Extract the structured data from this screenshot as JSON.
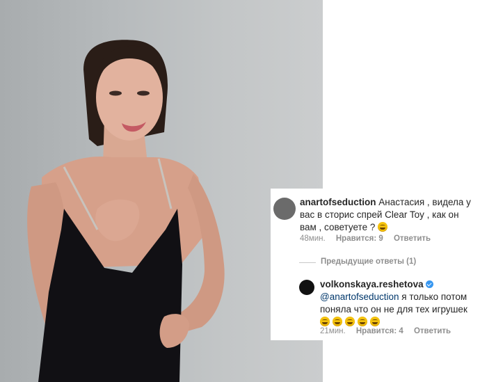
{
  "comments": [
    {
      "username": "anartofseduction",
      "text": "Анастасия , видела у вас в сторис спрей Clear Toy , как  он вам , советуете ?",
      "time": "48мин.",
      "likes": "Нравится: 9",
      "reply": "Ответить"
    },
    {
      "username": "volkonskaya.reshetova",
      "mention": "@anartofseduction",
      "text": "я только потом поняла что он не для тех игрушек",
      "time": "21мин.",
      "likes": "Нравится: 4",
      "reply": "Ответить"
    }
  ],
  "previous_replies": "Предыдущие ответы (1)",
  "colors": {
    "text": "#262626",
    "meta": "#8e8e8e",
    "mention": "#00376b",
    "verified": "#3897f0",
    "photo_bg": "#b9bcbe"
  }
}
